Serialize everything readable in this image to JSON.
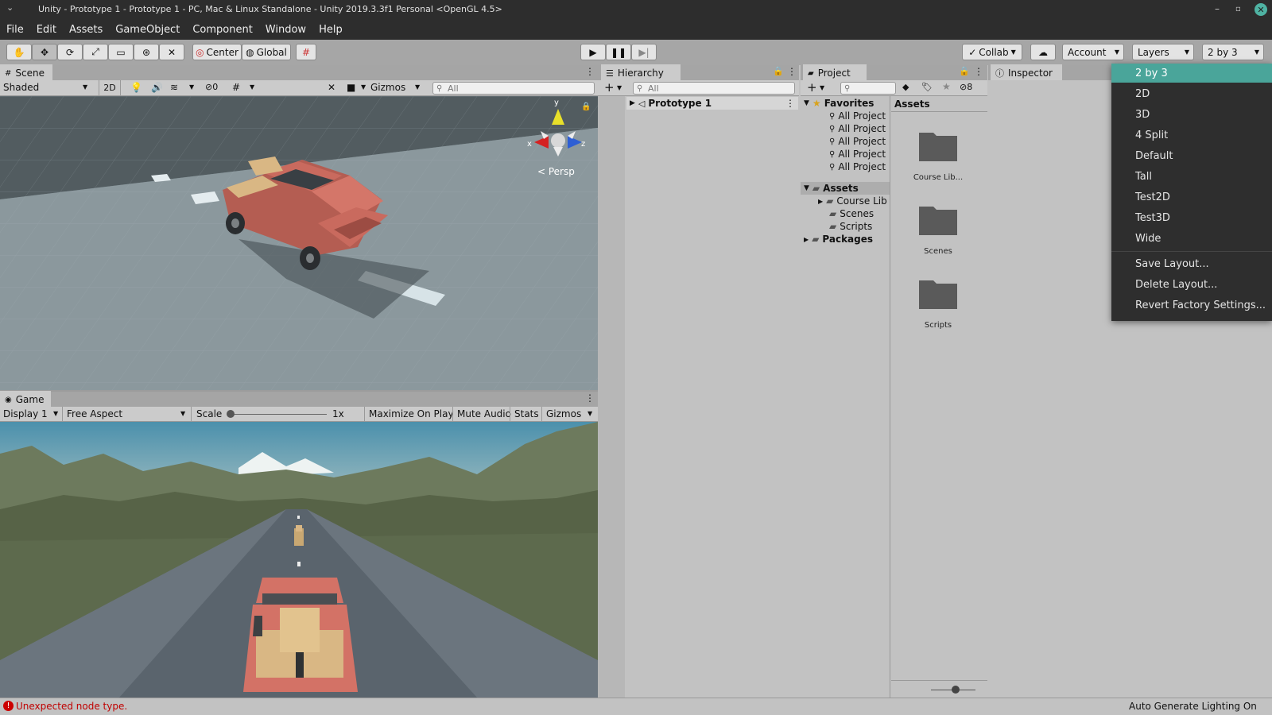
{
  "window": {
    "title": "Unity - Prototype 1 - Prototype 1 - PC, Mac & Linux Standalone - Unity 2019.3.3f1 Personal <OpenGL 4.5>"
  },
  "menu": [
    "File",
    "Edit",
    "Assets",
    "GameObject",
    "Component",
    "Window",
    "Help"
  ],
  "toolbar": {
    "center_label": "Center",
    "global_label": "Global",
    "collab_label": "Collab",
    "account_label": "Account",
    "layers_label": "Layers",
    "layout_label": "2 by 3"
  },
  "scene": {
    "tab_label": "Scene",
    "shading_mode": "Shaded",
    "mode_2d": "2D",
    "hidden_count": "0",
    "gizmos_label": "Gizmos",
    "search_placeholder": "All",
    "axis_y": "y",
    "axis_x": "x",
    "axis_z": "z",
    "persp_label": "< Persp"
  },
  "game": {
    "tab_label": "Game",
    "display": "Display 1",
    "aspect": "Free Aspect",
    "scale_label": "Scale",
    "scale_value": "1x",
    "maximize_on_play": "Maximize On Play",
    "mute_audio": "Mute Audio",
    "stats": "Stats",
    "gizmos_label": "Gizmos"
  },
  "hierarchy": {
    "tab_label": "Hierarchy",
    "search_placeholder": "All",
    "root_item": "Prototype 1"
  },
  "project": {
    "tab_label": "Project",
    "hidden_count": "8",
    "favorites_label": "Favorites",
    "favorites": [
      "All Project",
      "All Project",
      "All Project",
      "All Project",
      "All Project"
    ],
    "assets_label": "Assets",
    "asset_folders": [
      "Course Lib",
      "Scenes",
      "Scripts"
    ],
    "packages_label": "Packages",
    "breadcrumb": "Assets",
    "grid_items": [
      "Course Lib...",
      "Scenes",
      "Scripts"
    ]
  },
  "inspector": {
    "tab_label": "Inspector"
  },
  "layout_menu": {
    "items": [
      "2 by 3",
      "2D",
      "3D",
      "4 Split",
      "Default",
      "Tall",
      "Test2D",
      "Test3D",
      "Wide"
    ],
    "selected": "2 by 3",
    "actions": [
      "Save Layout...",
      "Delete Layout...",
      "Revert Factory Settings..."
    ]
  },
  "status": {
    "error_text": "Unexpected node type.",
    "lighting_text": "Auto Generate Lighting On"
  },
  "colors": {
    "menu_selected": "#4aa59a",
    "truck_body": "#c96a5e",
    "error": "#cc0000"
  }
}
